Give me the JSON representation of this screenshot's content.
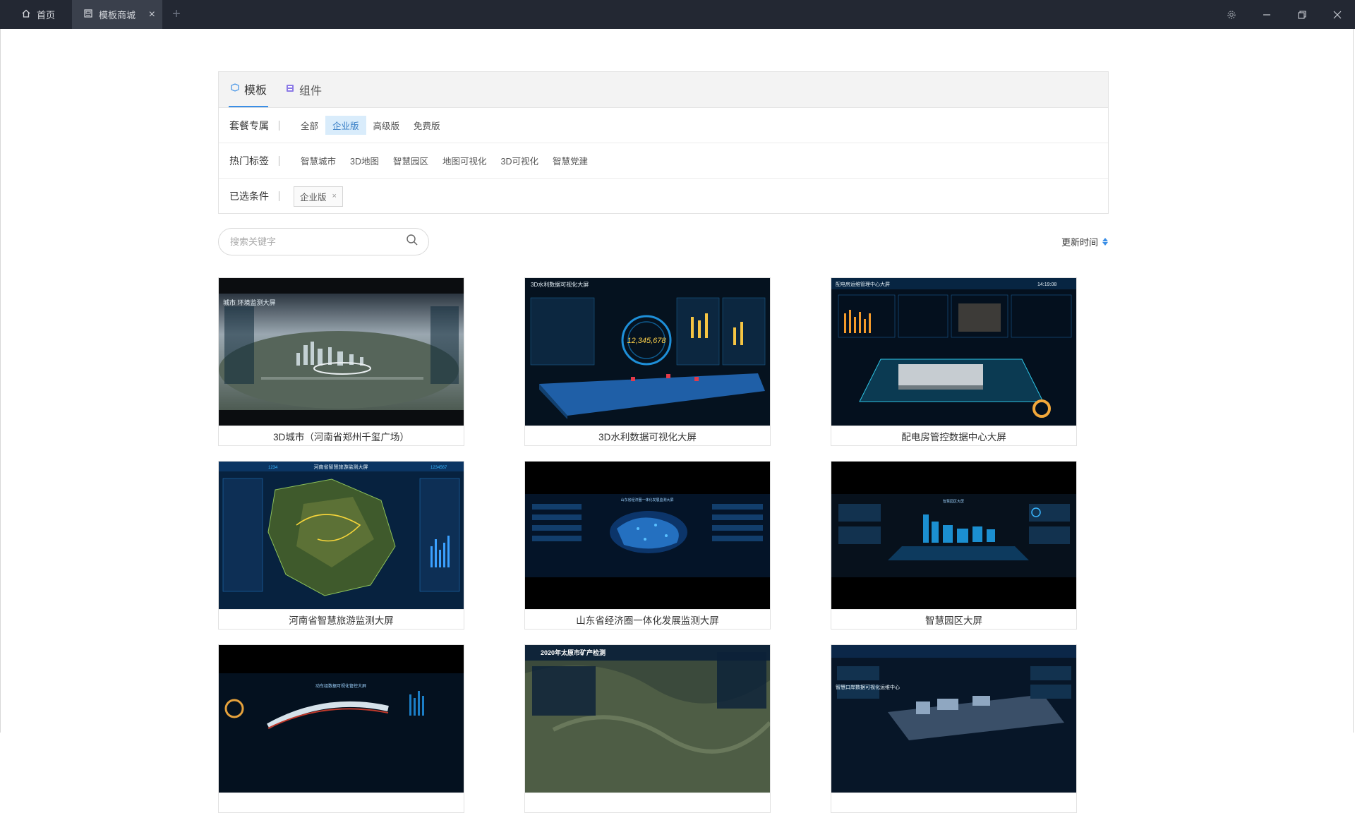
{
  "window": {
    "tabs": [
      {
        "label": "首页",
        "icon": "home-icon"
      },
      {
        "label": "模板商城",
        "icon": "template-icon",
        "active": true
      }
    ]
  },
  "filters": {
    "tabs": [
      {
        "label": "模板",
        "icon": "template-icon",
        "active": true
      },
      {
        "label": "组件",
        "icon": "component-icon",
        "active": false
      }
    ],
    "plan": {
      "label": "套餐专属",
      "options": [
        "全部",
        "企业版",
        "高级版",
        "免费版"
      ],
      "selected": "企业版"
    },
    "tags": {
      "label": "热门标签",
      "options": [
        "智慧城市",
        "3D地图",
        "智慧园区",
        "地图可视化",
        "3D可视化",
        "智慧党建"
      ]
    },
    "chosen": {
      "label": "已选条件",
      "chips": [
        "企业版"
      ]
    }
  },
  "search": {
    "placeholder": "搜索关键字",
    "value": ""
  },
  "sort": {
    "label": "更新时间"
  },
  "cards": [
    {
      "title": "3D城市（河南省郑州千玺广场）",
      "thumb_text": "城市 环境监测大屏"
    },
    {
      "title": "3D水利数据可视化大屏",
      "thumb_text": "3D水利数据可视化大屏",
      "counter": "12,345,678"
    },
    {
      "title": "配电房管控数据中心大屏",
      "thumb_text": "配电房运维管理中心大屏",
      "time": "14:19:08"
    },
    {
      "title": "河南省智慧旅游监测大屏",
      "thumb_text": "河南省智慧旅游监测大屏",
      "left_num": "1234",
      "right_num": "1234567"
    },
    {
      "title": "山东省经济圈一体化发展监测大屏",
      "thumb_text": "山东省经济圈一体化发展监测大屏"
    },
    {
      "title": "智慧园区大屏",
      "thumb_text": "智慧园区大屏"
    },
    {
      "title": "",
      "thumb_text": "动车组数据可视化管控大屏"
    },
    {
      "title": "",
      "thumb_text": "2020年太原市矿产检测"
    },
    {
      "title": "",
      "thumb_text": "智慧口岸数据可视化运维中心"
    }
  ],
  "colors": {
    "titlebar": "#232833",
    "active_tab": "#3a404c",
    "accent": "#3a8ee6",
    "selected_bg": "#d9ecfb"
  }
}
